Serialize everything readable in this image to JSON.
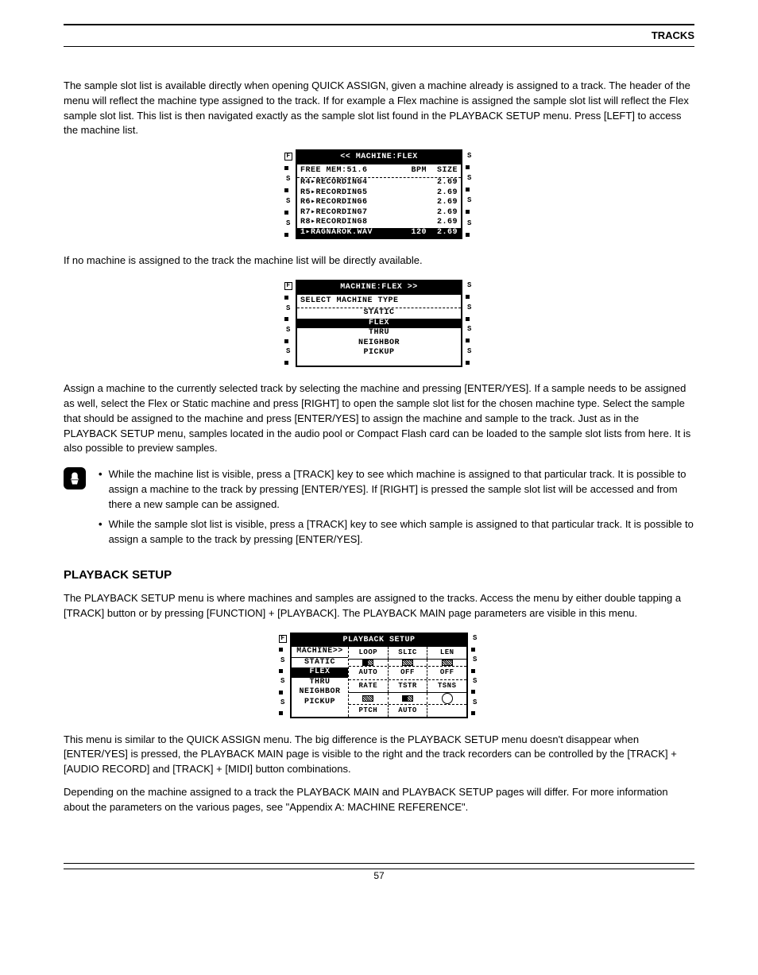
{
  "header": {
    "title": "TRACKS"
  },
  "para1": "The sample slot list is available directly when opening QUICK ASSIGN, given a machine already is assigned to a track. The header of the menu will reflect the machine type assigned to the track. If for example a Flex machine is assigned the sample slot list will reflect the Flex sample slot list. This list is then navigated exactly as the sample slot list found in the PLAYBACK SETUP menu. Press [LEFT] to access the machine list.",
  "lcd1": {
    "title": "<< MACHINE:FLEX",
    "mem_label": "FREE MEM:51.6",
    "col_bpm": "BPM",
    "col_size": "SIZE",
    "rows": [
      {
        "slot": "R4",
        "name": "RECORDING4",
        "bpm": "",
        "size": "2.69"
      },
      {
        "slot": "R5",
        "name": "RECORDING5",
        "bpm": "",
        "size": "2.69"
      },
      {
        "slot": "R6",
        "name": "RECORDING6",
        "bpm": "",
        "size": "2.69"
      },
      {
        "slot": "R7",
        "name": "RECORDING7",
        "bpm": "",
        "size": "2.69"
      },
      {
        "slot": "R8",
        "name": "RECORDING8",
        "bpm": "",
        "size": "2.69"
      }
    ],
    "sel": {
      "slot": "1",
      "name": "RAGNAROK.WAV",
      "bpm": "120",
      "size": "2.69"
    }
  },
  "listPara": "If no machine is assigned to the track the machine list will be directly available.",
  "lcd2": {
    "title": "MACHINE:FLEX >>",
    "subtitle": "SELECT MACHINE TYPE",
    "items": [
      "STATIC",
      "FLEX",
      "THRU",
      "NEIGHBOR",
      "PICKUP"
    ],
    "selectedIndex": 1
  },
  "afterList1": "Assign a machine to the currently selected track by selecting the machine and pressing [ENTER/YES]. If a sample needs to be assigned as well, select the Flex or Static machine and press [RIGHT] to open the sample slot list for the chosen machine type. Select the sample that should be assigned to the machine and press [ENTER/YES] to assign the machine and sample to the track. Just as in the PLAYBACK SETUP menu, samples located in the audio pool or Compact Flash card can be loaded to the sample slot lists from here. It is also possible to preview samples.",
  "noteBullet1": "While the machine list is visible, press a [TRACK] key to see which machine is assigned to that particular track. It is possible to assign a machine to the track by pressing [ENTER/YES]. If [RIGHT] is pressed the sample slot list will be accessed and from there a new sample can be assigned.",
  "noteBullet2": "While the sample slot list is visible, press a [TRACK] key to see which sample is assigned to that particular track. It is possible to assign a sample to the track by pressing [ENTER/YES].",
  "sectionTitle": "PLAYBACK SETUP",
  "playbackPara": "The PLAYBACK SETUP menu is where machines and samples are assigned to the tracks. Access the menu by either double tapping a [TRACK] button or by pressing [FUNCTION] + [PLAYBACK]. The PLAYBACK MAIN page parameters are visible in this menu.",
  "lcd3": {
    "title": "PLAYBACK SETUP",
    "left_header": "MACHINE>>",
    "left_items": [
      "STATIC",
      "FLEX",
      "THRU",
      "NEIGHBOR",
      "PICKUP"
    ],
    "left_selected": 1,
    "params": {
      "row1head": [
        "LOOP",
        "SLIC",
        "LEN"
      ],
      "row2": [
        "AUTO",
        "OFF",
        "OFF"
      ],
      "row3head": [
        "RATE",
        "TSTR",
        "TSNS"
      ],
      "row4": [
        "PTCH",
        "AUTO"
      ]
    }
  },
  "afterLcd3_1": "This menu is similar to the QUICK ASSIGN menu. The big difference is the PLAYBACK SETUP menu doesn't disappear when [ENTER/YES] is pressed, the PLAYBACK MAIN page is visible to the right and the track recorders can be controlled by the [TRACK] + [AUDIO RECORD] and [TRACK] + [MIDI] button combinations.",
  "afterLcd3_2": "Depending on the machine assigned to a track the PLAYBACK MAIN and PLAYBACK SETUP pages will differ. For more information about the parameters on the various pages, see \"Appendix A: MACHINE REFERENCE\".",
  "footer": {
    "page": "57"
  }
}
